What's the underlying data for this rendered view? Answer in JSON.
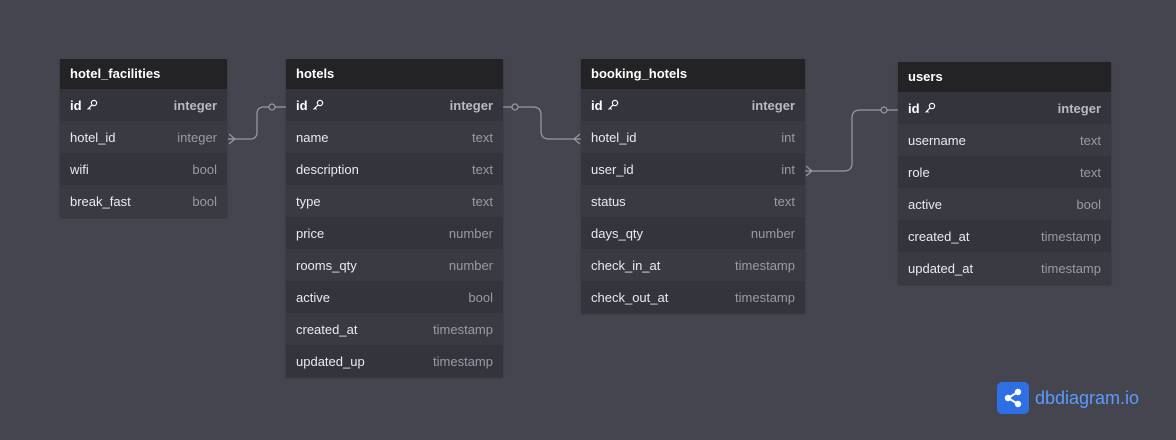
{
  "tables": {
    "hotel_facilities": {
      "name": "hotel_facilities",
      "fields": [
        {
          "name": "id",
          "type": "integer",
          "pk": true
        },
        {
          "name": "hotel_id",
          "type": "integer"
        },
        {
          "name": "wifi",
          "type": "bool"
        },
        {
          "name": "break_fast",
          "type": "bool"
        }
      ]
    },
    "hotels": {
      "name": "hotels",
      "fields": [
        {
          "name": "id",
          "type": "integer",
          "pk": true
        },
        {
          "name": "name",
          "type": "text"
        },
        {
          "name": "description",
          "type": "text"
        },
        {
          "name": "type",
          "type": "text"
        },
        {
          "name": "price",
          "type": "number"
        },
        {
          "name": "rooms_qty",
          "type": "number"
        },
        {
          "name": "active",
          "type": "bool"
        },
        {
          "name": "created_at",
          "type": "timestamp"
        },
        {
          "name": "updated_up",
          "type": "timestamp"
        }
      ]
    },
    "booking_hotels": {
      "name": "booking_hotels",
      "fields": [
        {
          "name": "id",
          "type": "integer",
          "pk": true
        },
        {
          "name": "hotel_id",
          "type": "int"
        },
        {
          "name": "user_id",
          "type": "int"
        },
        {
          "name": "status",
          "type": "text"
        },
        {
          "name": "days_qty",
          "type": "number"
        },
        {
          "name": "check_in_at",
          "type": "timestamp"
        },
        {
          "name": "check_out_at",
          "type": "timestamp"
        }
      ]
    },
    "users": {
      "name": "users",
      "fields": [
        {
          "name": "id",
          "type": "integer",
          "pk": true
        },
        {
          "name": "username",
          "type": "text"
        },
        {
          "name": "role",
          "type": "text"
        },
        {
          "name": "active",
          "type": "bool"
        },
        {
          "name": "created_at",
          "type": "timestamp"
        },
        {
          "name": "updated_at",
          "type": "timestamp"
        }
      ]
    }
  },
  "relations": [
    {
      "from": "hotel_facilities.hotel_id",
      "to": "hotels.id",
      "type": "many-to-one"
    },
    {
      "from": "booking_hotels.hotel_id",
      "to": "hotels.id",
      "type": "many-to-one"
    },
    {
      "from": "booking_hotels.user_id",
      "to": "users.id",
      "type": "many-to-one"
    }
  ],
  "brand": {
    "logo_text": "dbdiagram.io",
    "icon": "share-nodes-icon",
    "accent": "#2f6fe6"
  },
  "colors": {
    "background": "#45454f",
    "header": "#232325",
    "table_body": "#34343d",
    "connector": "#9a9aa5"
  }
}
